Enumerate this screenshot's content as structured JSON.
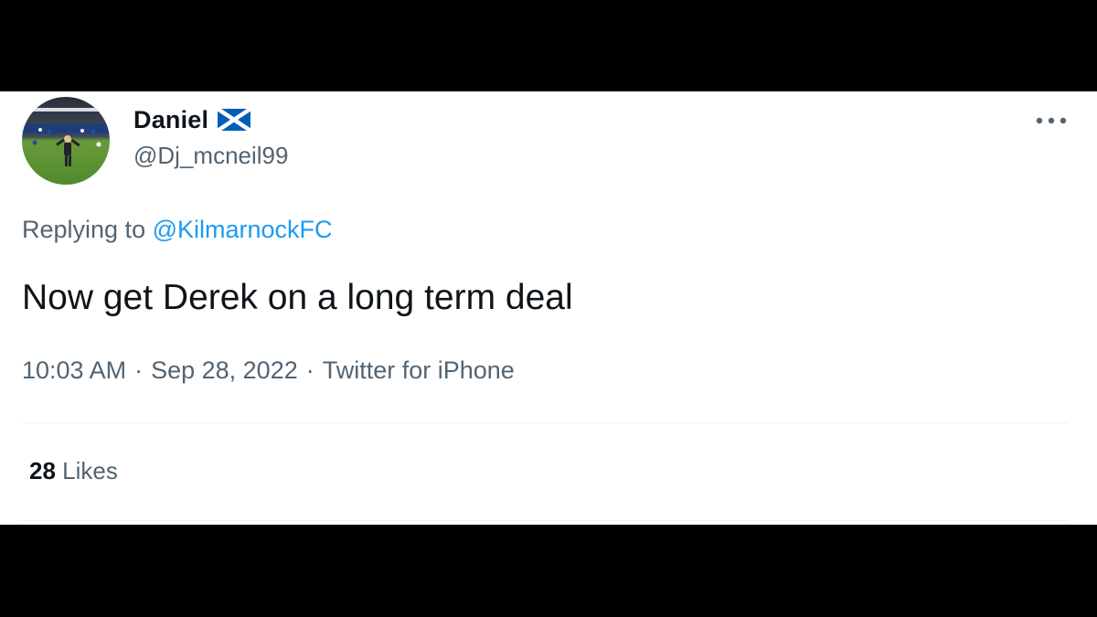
{
  "tweet": {
    "author": {
      "display_name": "Daniel",
      "flag_icon": "scotland-flag-icon",
      "handle": "@Dj_mcneil99",
      "avatar": "avatar-photo"
    },
    "more_icon": "more-horizontal-icon",
    "replying_to_label": "Replying to",
    "replying_to_handle": "@KilmarnockFC",
    "text": "Now get Derek on a long term deal",
    "time": "10:03 AM",
    "separator": "·",
    "date": "Sep 28, 2022",
    "source": "Twitter for iPhone",
    "likes_count": "28",
    "likes_label": "Likes"
  },
  "colors": {
    "primary_text": "#0f1419",
    "secondary_text": "#536471",
    "link": "#1d9bf0",
    "flag_blue": "#005eb8",
    "background": "#ffffff",
    "letterbox": "#000000"
  }
}
